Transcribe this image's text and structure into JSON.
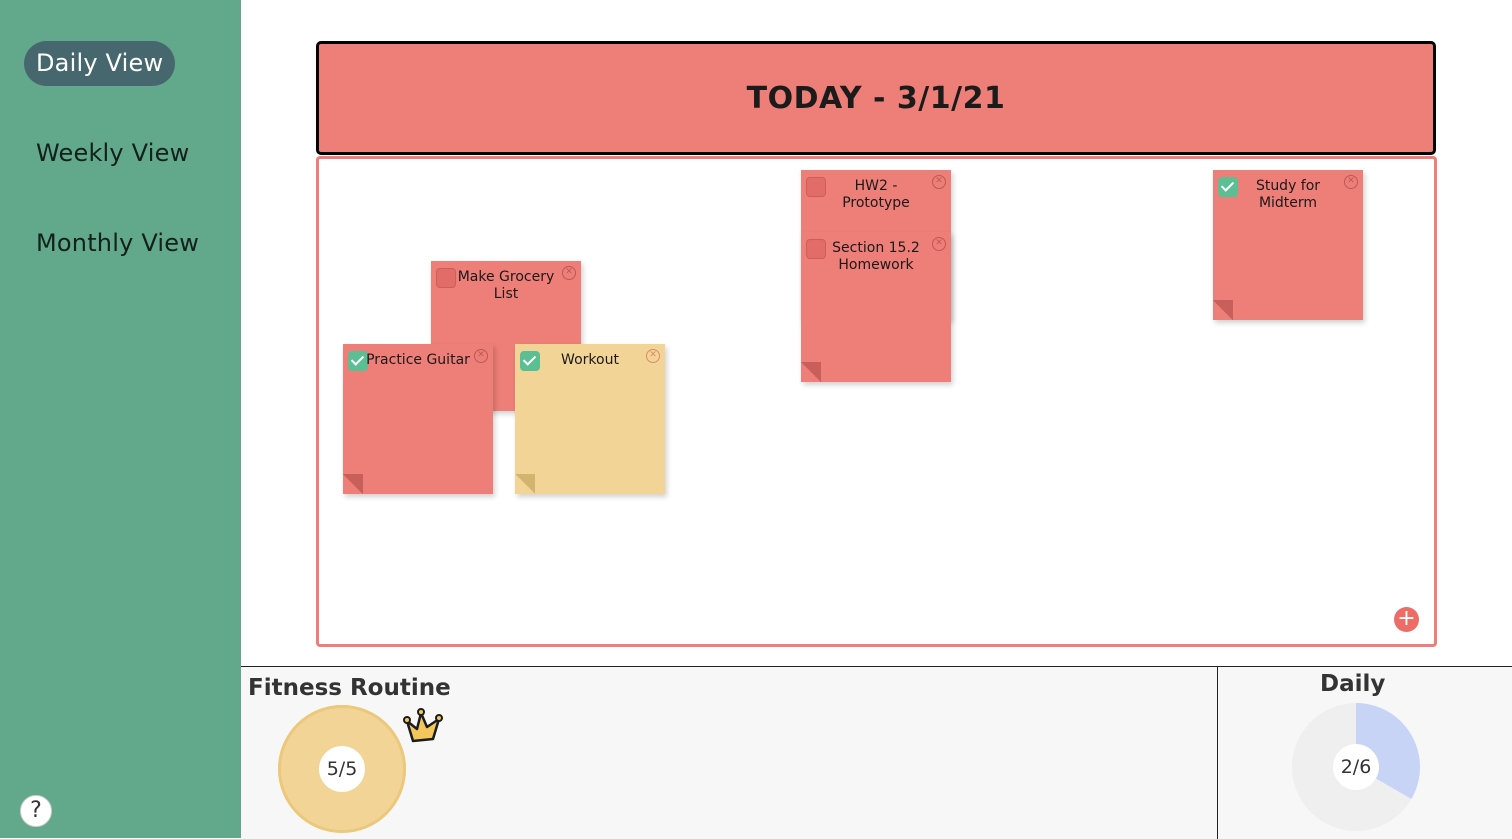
{
  "nav": {
    "items": [
      {
        "label": "Daily View"
      },
      {
        "label": "Weekly View"
      },
      {
        "label": "Monthly View"
      }
    ],
    "help_label": "?"
  },
  "header": {
    "title": "TODAY - 3/1/21"
  },
  "board": {
    "add_label": "+",
    "notes": [
      {
        "text": "Make Grocery List",
        "checked": false,
        "color": "#ee7e78"
      },
      {
        "text": "Practice Guitar",
        "checked": true,
        "color": "#ee7e78"
      },
      {
        "text": "Workout",
        "checked": true,
        "color": "#f2d596"
      },
      {
        "text": "HW2 - Prototype",
        "checked": false,
        "color": "#ee7e78"
      },
      {
        "text": "Section 15.2 Homework",
        "checked": false,
        "color": "#ee7e78"
      },
      {
        "text": "Study for Midterm",
        "checked": true,
        "color": "#ee7e78"
      }
    ]
  },
  "fitness": {
    "title": "Fitness Routine",
    "progress_label": "5/5",
    "completed": 5,
    "total": 5,
    "color": "#f2d596"
  },
  "daily": {
    "title": "Daily",
    "progress_label": "2/6",
    "completed": 2,
    "total": 6,
    "color": "#c8d4f5"
  },
  "icons": {
    "crown": "crown-icon",
    "check": "check-icon",
    "close": "close-icon",
    "add": "plus-icon",
    "help": "question-icon"
  }
}
